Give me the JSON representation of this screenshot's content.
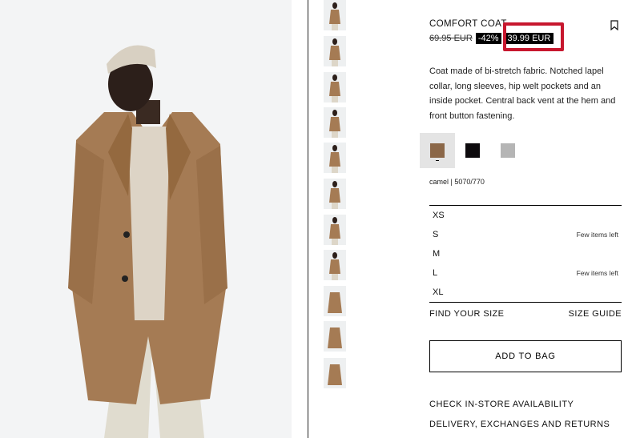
{
  "product": {
    "title": "COMFORT COAT",
    "price_old": "69.95 EUR",
    "discount": "-42%",
    "price_new": "39.99 EUR",
    "description": "Coat made of bi-stretch fabric. Notched lapel collar, long sleeves, hip welt pockets and an inside pocket. Central back vent at the hem and front button fastening.",
    "color_label": "camel | 5070/770"
  },
  "colors": {
    "camel": "#8b6748",
    "black": "#0d0a0d",
    "grey": "#b5b5b5",
    "highlight": "#c7172e",
    "coat": "#a57b54"
  },
  "swatches": [
    {
      "name": "camel",
      "hex": "#8b6748",
      "selected": true
    },
    {
      "name": "black",
      "hex": "#0d0a0d",
      "selected": false
    },
    {
      "name": "grey",
      "hex": "#b5b5b5",
      "selected": false
    }
  ],
  "sizes": [
    {
      "label": "XS",
      "stock": ""
    },
    {
      "label": "S",
      "stock": "Few items left"
    },
    {
      "label": "M",
      "stock": ""
    },
    {
      "label": "L",
      "stock": "Few items left"
    },
    {
      "label": "XL",
      "stock": ""
    }
  ],
  "helpers": {
    "find_size": "FIND YOUR SIZE",
    "size_guide": "SIZE GUIDE"
  },
  "add_to_bag": "ADD TO BAG",
  "links": {
    "store": "CHECK IN-STORE AVAILABILITY",
    "delivery": "DELIVERY, EXCHANGES AND RETURNS"
  },
  "icons": {
    "bookmark": "bookmark-icon"
  }
}
